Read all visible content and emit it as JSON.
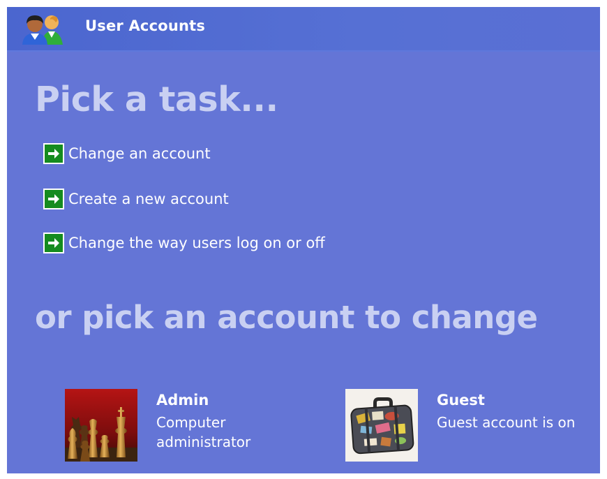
{
  "window": {
    "title": "User Accounts",
    "title_icon": "users-icon"
  },
  "tasks": {
    "heading": "Pick a task...",
    "items": [
      {
        "label": "Change an account",
        "icon": "green-arrow-icon"
      },
      {
        "label": "Create a new account",
        "icon": "green-arrow-icon"
      },
      {
        "label": "Change the way users log on or off",
        "icon": "green-arrow-icon"
      }
    ]
  },
  "accounts": {
    "heading": "or pick an account to change",
    "items": [
      {
        "name": "Admin",
        "description": "Computer administrator",
        "picture": "chess-pieces-picture"
      },
      {
        "name": "Guest",
        "description": "Guest account is on",
        "picture": "suitcase-picture"
      }
    ]
  },
  "colors": {
    "background": "#6475d6",
    "titlebar": "#4b66cf",
    "heading": "#c9d0f2",
    "arrow_bg": "#158b1f",
    "text": "#ffffff"
  }
}
